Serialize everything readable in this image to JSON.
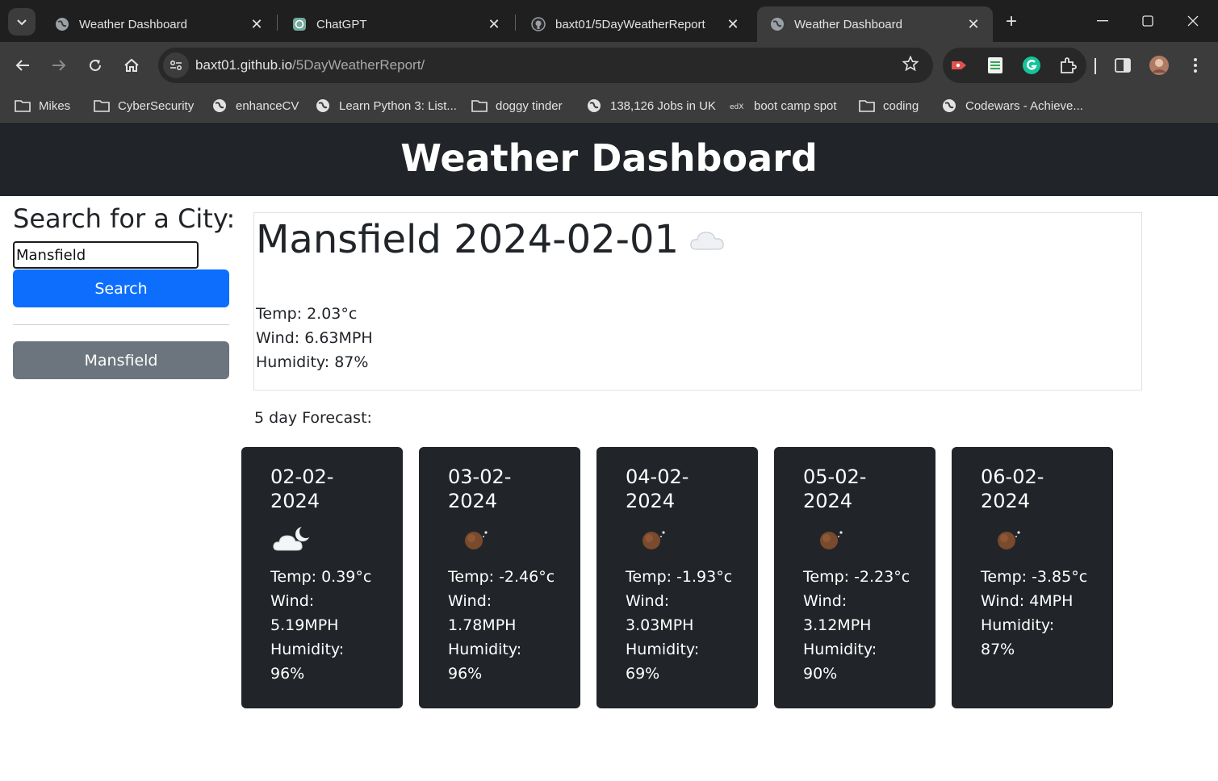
{
  "browser": {
    "tabs": [
      {
        "title": "Weather Dashboard",
        "icon": "globe-icon",
        "active": false
      },
      {
        "title": "ChatGPT",
        "icon": "chatgpt-icon",
        "active": false
      },
      {
        "title": "baxt01/5DayWeatherReport",
        "icon": "github-icon",
        "active": false
      },
      {
        "title": "Weather Dashboard",
        "icon": "globe-icon",
        "active": true
      }
    ],
    "url_host": "baxt01.github.io",
    "url_path": "/5DayWeatherReport/",
    "bookmarks": [
      {
        "label": "Mikes",
        "icon": "folder-icon"
      },
      {
        "label": "CyberSecurity",
        "icon": "folder-icon"
      },
      {
        "label": "enhanceCV",
        "icon": "globe-icon"
      },
      {
        "label": "Learn Python 3: List...",
        "icon": "globe-icon"
      },
      {
        "label": "doggy tinder",
        "icon": "folder-icon"
      },
      {
        "label": "138,126 Jobs in UK",
        "icon": "globe-icon"
      },
      {
        "label": "boot camp spot",
        "icon": "edx-icon"
      },
      {
        "label": "coding",
        "icon": "folder-icon"
      },
      {
        "label": "Codewars - Achieve...",
        "icon": "globe-icon"
      }
    ]
  },
  "page": {
    "header": "Weather Dashboard",
    "search": {
      "heading": "Search for a City:",
      "input_value": "Mansfield",
      "button": "Search"
    },
    "history": [
      "Mansfield"
    ],
    "current": {
      "title": "Mansfield 2024-02-01",
      "icon": "cloud-icon",
      "temp": "Temp: 2.03°c",
      "wind": "Wind: 6.63MPH",
      "humidity": "Humidity: 87%"
    },
    "forecast_label": "5 day Forecast:",
    "forecast": [
      {
        "date": "02-02-2024",
        "icon": "cloud-moon-icon",
        "temp": "Temp: 0.39°c",
        "wind_label": "Wind:",
        "wind_value": "5.19MPH",
        "humidity_label": "Humidity:",
        "humidity_value": "96%"
      },
      {
        "date": "03-02-2024",
        "icon": "clear-night-icon",
        "temp": "Temp: -2.46°c",
        "wind_label": "Wind:",
        "wind_value": "1.78MPH",
        "humidity_label": "Humidity:",
        "humidity_value": "96%"
      },
      {
        "date": "04-02-2024",
        "icon": "clear-night-icon",
        "temp": "Temp: -1.93°c",
        "wind_label": "Wind:",
        "wind_value": "3.03MPH",
        "humidity_label": "Humidity:",
        "humidity_value": "69%"
      },
      {
        "date": "05-02-2024",
        "icon": "clear-night-icon",
        "temp": "Temp: -2.23°c",
        "wind_label": "Wind:",
        "wind_value": "3.12MPH",
        "humidity_label": "Humidity:",
        "humidity_value": "90%"
      },
      {
        "date": "06-02-2024",
        "icon": "clear-night-icon",
        "temp": "Temp: -3.85°c",
        "wind_label": "Wind: 4MPH",
        "wind_value": "",
        "humidity_label": "Humidity:",
        "humidity_value": "87%"
      }
    ]
  },
  "colors": {
    "header_bg": "#212529",
    "search_button": "#0d6efd",
    "history_button": "#6c757d",
    "card_bg": "#212529"
  }
}
